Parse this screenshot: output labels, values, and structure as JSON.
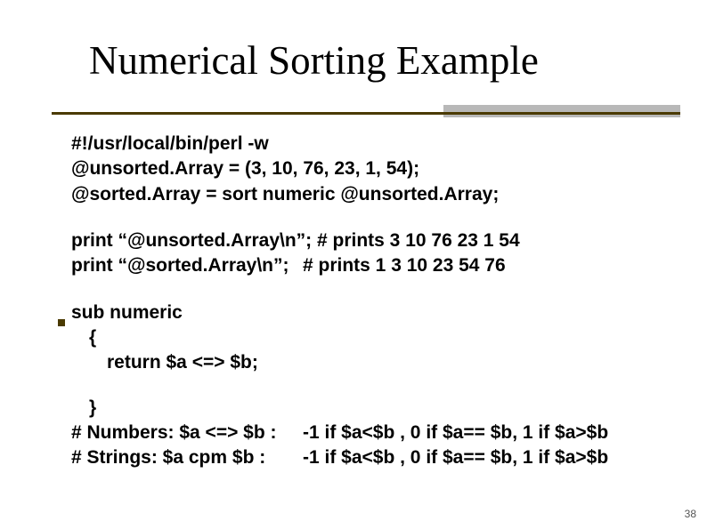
{
  "title": "Numerical Sorting Example",
  "code": {
    "l1": "#!/usr/local/bin/perl -w",
    "l2": "@unsorted.Array = (3, 10, 76, 23, 1, 54);",
    "l3": "@sorted.Array = sort numeric @unsorted.Array;",
    "p1": "print “@unsorted.Array\\n”; # prints 3 10 76 23 1 54",
    "p2a": "print “@sorted.Array\\n”;",
    "p2b": "# prints 1 3 10 23 54 76",
    "s1": "sub numeric",
    "s2": "{",
    "s3": "return $a <=> $b;",
    "s4": "}",
    "c1a": "# Numbers: $a <=> $b :",
    "c1b": "-1 if $a<$b , 0  if $a== $b, 1 if $a>$b",
    "c2a": "# Strings:      $a cpm $b :",
    "c2b": "-1 if $a<$b , 0  if $a== $b, 1 if $a>$b"
  },
  "slide_number": "38"
}
